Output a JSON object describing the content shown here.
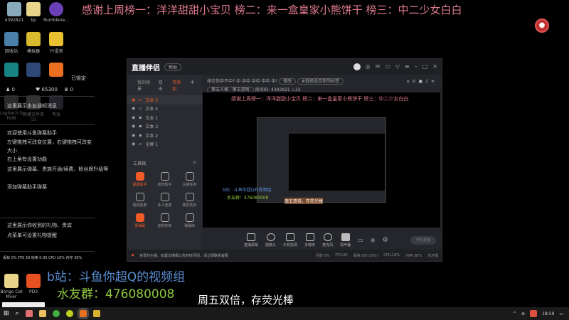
{
  "banner": "感谢上周榜一：洋洋甜甜小宝贝 榜二：来一盒皇家小熊饼干 榜三：中二少女白白",
  "desktop_icons": [
    {
      "label": "4392821"
    },
    {
      "label": "bp"
    },
    {
      "label": "Rumbleve..."
    },
    {
      "label": "回收站"
    },
    {
      "label": "模拟器"
    },
    {
      "label": "YY语音"
    },
    {
      "label": "Logitech G HUB"
    },
    {
      "label": "新建文件夹 (2)"
    },
    {
      "label": "夸张"
    },
    {
      "label": "Bongo Cat Mver"
    },
    {
      "label": "PD3"
    }
  ],
  "overlay": {
    "status_locked": "已锁定",
    "likes": "0",
    "gifts": "65300",
    "crowns": "0",
    "msgs": [
      "这里展示水友通知消息",
      "欢迎使用斗鱼弹幕助手",
      "左键拖拽可改变位置，右键拖拽可改变",
      "大小",
      "右上角有设置功能",
      "这里展示弹幕、贵族开通/续费、粉丝牌升级等",
      "添加弹幕助手弹幕",
      "这里展示你收到的礼物、贵宾",
      "点菜单可设置礼物提醒"
    ],
    "perf": "丢帧 0%  FPS 30  帧率 0.00  CPU 10%  内存 36%"
  },
  "app": {
    "name": "直播伴侣",
    "badge": "帮助",
    "tabs": [
      "我的场景",
      "双击",
      "可添加"
    ],
    "layers": [
      "文本 5",
      "文本 4",
      "文本 1",
      "文本 3",
      "文本 2",
      "全屏 1"
    ],
    "title_line": "排位你中不中? 中 中中 中中 中中 中!",
    "edit_btn": "修改",
    "tag": "#选择适合你的标签",
    "category": "第五人格 · 第五游戏",
    "room_label": "房间ID:",
    "room_id": "4392821",
    "fans": "32",
    "toolbox": "工具箱",
    "tools": [
      "弹幕助手",
      "房管助手",
      "主播任务",
      "视频连麦",
      "多人连麦",
      "楼层助手",
      "录弹幕",
      "虚拟形象",
      "弹幕库"
    ],
    "controls": [
      "直播屏幕",
      "摄像头",
      "手机投屏",
      "多媒体",
      "麦克风",
      "扬声器"
    ],
    "start": "开始直播",
    "notice": "亲爱的主播，如遇文播报公告的时间间，请立即联系客服",
    "stats": [
      "回放 0%",
      "FPS:30",
      "丢帧:0(0.00%)",
      "CPU:18%",
      "内存:38%",
      "未开播"
    ]
  },
  "bottom": {
    "bili": "b站：斗鱼你超Q的视频组",
    "qq": "水友群：476080008",
    "promo": "周五双倍，存荧光棒"
  },
  "taskbar": {
    "time": "18:59"
  }
}
